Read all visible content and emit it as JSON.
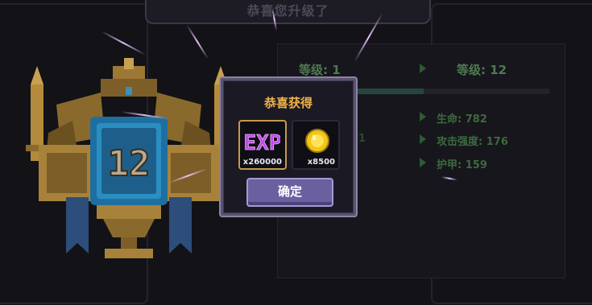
{
  "banner": {
    "title": "恭喜您升级了"
  },
  "stats": {
    "old_level": "等级: 1",
    "new_level": "等级: 12",
    "hp": "生命: 782",
    "attack": "攻击强度: 176",
    "armor": "护甲: 159",
    "partial_value": "1"
  },
  "trophy": {
    "level_number": "12"
  },
  "popup": {
    "title": "恭喜获得",
    "rewards": [
      {
        "icon": "exp-icon",
        "label": "EXP",
        "count": "x260000"
      },
      {
        "icon": "gold-coin-icon",
        "count": "x8500"
      }
    ],
    "confirm_label": "确定"
  },
  "colors": {
    "popup_title": "#f0b24a",
    "button": "#6a60a0",
    "stat_green": "#3c6a3f",
    "exp_purple": "#c04ae8",
    "gold": "#f2c61a"
  }
}
